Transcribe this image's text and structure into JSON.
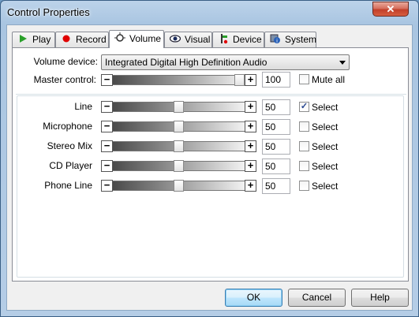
{
  "window": {
    "title": "Control Properties",
    "close_label": "✕"
  },
  "tabs": [
    {
      "label": "Play",
      "icon": "play-icon",
      "active": false
    },
    {
      "label": "Record",
      "icon": "record-icon",
      "active": false
    },
    {
      "label": "Volume",
      "icon": "volume-icon",
      "active": true
    },
    {
      "label": "Visual",
      "icon": "eye-icon",
      "active": false
    },
    {
      "label": "Device",
      "icon": "device-icon",
      "active": false
    },
    {
      "label": "System",
      "icon": "system-icon",
      "active": false
    }
  ],
  "volume_device": {
    "label": "Volume device:",
    "value": "Integrated Digital High Definition Audio"
  },
  "master": {
    "label": "Master control:",
    "value": "100",
    "level": 1.0,
    "mute_label": "Mute all",
    "mute_checked": false
  },
  "channels": [
    {
      "label": "Line",
      "value": "50",
      "level": 0.5,
      "select_label": "Select",
      "checked": true
    },
    {
      "label": "Microphone",
      "value": "50",
      "level": 0.5,
      "select_label": "Select",
      "checked": false
    },
    {
      "label": "Stereo Mix",
      "value": "50",
      "level": 0.5,
      "select_label": "Select",
      "checked": false
    },
    {
      "label": "CD Player",
      "value": "50",
      "level": 0.5,
      "select_label": "Select",
      "checked": false
    },
    {
      "label": "Phone Line",
      "value": "50",
      "level": 0.5,
      "select_label": "Select",
      "checked": false
    }
  ],
  "slider": {
    "minus": "−",
    "plus": "+"
  },
  "buttons": {
    "ok": "OK",
    "cancel": "Cancel",
    "help": "Help"
  },
  "colors": {
    "record": "#e00000",
    "play": "#2aa02a",
    "close": "#c2402a"
  }
}
